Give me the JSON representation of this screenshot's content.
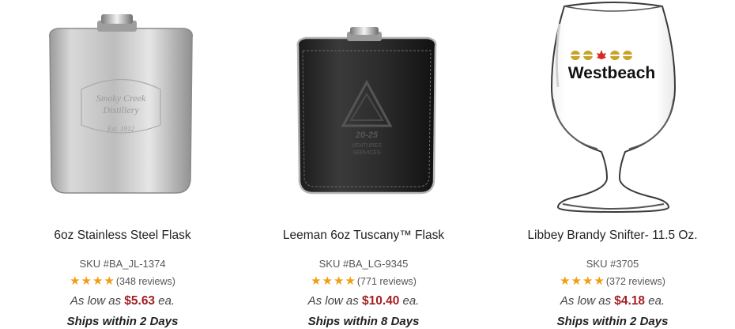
{
  "products": [
    {
      "title": "6oz Stainless Steel Flask",
      "sku": "SKU #BA_JL-1374",
      "stars": 4,
      "reviews": "(348 reviews)",
      "price_prefix": "As low as",
      "price": "$5.63",
      "price_suffix": "ea.",
      "ships": "Ships within 2 Days",
      "image_icon": "stainless-flask-icon",
      "engraving_line1": "Smoky Creek",
      "engraving_line2": "Distillery",
      "engraving_line3": "Est. 1912"
    },
    {
      "title": "Leeman 6oz Tuscany™ Flask",
      "sku": "SKU #BA_LG-9345",
      "stars": 4,
      "reviews": "(771 reviews)",
      "price_prefix": "As low as",
      "price": "$10.40",
      "price_suffix": "ea.",
      "ships": "Ships within 8 Days",
      "image_icon": "leather-flask-icon",
      "engraving_line1": "20-25",
      "engraving_line2": "VENTURES",
      "engraving_line3": "SERVICES"
    },
    {
      "title": "Libbey Brandy Snifter- 11.5 Oz.",
      "sku": "SKU #3705",
      "stars": 4,
      "reviews": "(372 reviews)",
      "price_prefix": "As low as",
      "price": "$4.18",
      "price_suffix": "ea.",
      "ships": "Ships within 2 Days",
      "image_icon": "brandy-snifter-icon",
      "logo_text": "Westbeach"
    }
  ],
  "colors": {
    "price": "#a31f24",
    "star": "#f39c12",
    "logo_gold": "#c9a227",
    "logo_red": "#d62b20"
  }
}
